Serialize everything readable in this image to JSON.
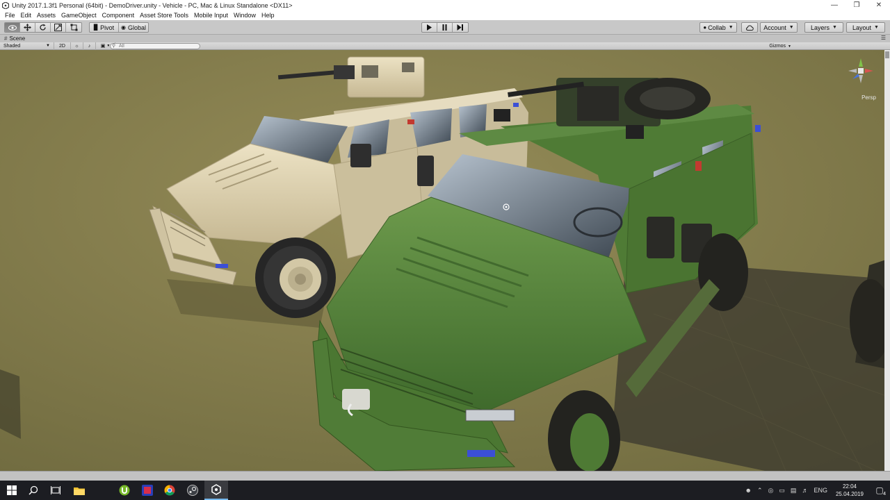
{
  "window": {
    "title": "Unity 2017.1.3f1 Personal (64bit) - DemoDriver.unity - Vehicle - PC, Mac & Linux Standalone <DX11>",
    "controls": [
      "minimize-icon",
      "maximize-icon",
      "close-icon"
    ]
  },
  "menu": {
    "items": [
      "File",
      "Edit",
      "Assets",
      "GameObject",
      "Component",
      "Asset Store Tools",
      "Mobile Input",
      "Window",
      "Help"
    ]
  },
  "toolbar": {
    "tools": [
      "hand-tool-icon",
      "move-tool-icon",
      "rotate-tool-icon",
      "scale-tool-icon",
      "rect-tool-icon"
    ],
    "pivot_label": "Pivot",
    "global_label": "Global",
    "collab_label": "Collab",
    "account_label": "Account",
    "layers_label": "Layers",
    "layout_label": "Layout"
  },
  "scene_tab": {
    "label": "Scene"
  },
  "scene_controls": {
    "shading_mode": "Shaded",
    "mode_2d": "2D",
    "gizmos_label": "Gizmos",
    "search_placeholder": "All"
  },
  "viewport": {
    "projection_label": "Persp"
  },
  "taskbar": {
    "language": "ENG",
    "time": "22:04",
    "date": "25.04.2019",
    "notification_count": "4"
  },
  "colors": {
    "ground": "#847c4a",
    "tan_vehicle": "#d8ccaa",
    "green_vehicle": "#56843a",
    "taskbar": "#1c1d22"
  }
}
